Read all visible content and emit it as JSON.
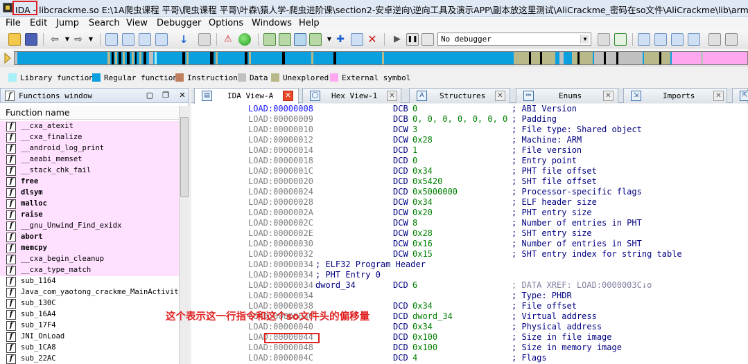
{
  "title_bar": {
    "app_name": "IDA - ",
    "title": "libcrackme.so E:\\1A爬虫课程 平哥\\爬虫课程 平哥\\叶森\\猿人学-爬虫进阶课\\section2-安卓逆向\\逆向工具及演示APP\\副本放这里测试\\AliCrackme_密码在so文件\\AliCrackme\\lib\\armeabi\\libcrackme.so"
  },
  "menu": [
    "File",
    "Edit",
    "Jump",
    "Search",
    "View",
    "Debugger",
    "Options",
    "Windows",
    "Help"
  ],
  "toolbar": {
    "debugger_select": "No debugger"
  },
  "legend": [
    {
      "label": "Library function",
      "color": "#a8f0f8"
    },
    {
      "label": "Regular function",
      "color": "#0aa0e0"
    },
    {
      "label": "Instruction",
      "color": "#c08060"
    },
    {
      "label": "Data",
      "color": "#c0c0c0"
    },
    {
      "label": "Unexplored",
      "color": "#b8b888"
    },
    {
      "label": "External symbol",
      "color": "#ffa8f0"
    }
  ],
  "functions_window": {
    "title": "Functions window",
    "column_header": "Function name",
    "items": [
      {
        "name": "__cxa_atexit",
        "kind": "imported"
      },
      {
        "name": "__cxa_finalize",
        "kind": "imported"
      },
      {
        "name": "__android_log_print",
        "kind": "imported"
      },
      {
        "name": "__aeabi_memset",
        "kind": "imported"
      },
      {
        "name": "__stack_chk_fail",
        "kind": "imported"
      },
      {
        "name": "free",
        "kind": "imported_bold"
      },
      {
        "name": "dlsym",
        "kind": "imported_bold"
      },
      {
        "name": "malloc",
        "kind": "imported_bold"
      },
      {
        "name": "raise",
        "kind": "imported_bold"
      },
      {
        "name": "__gnu_Unwind_Find_exidx",
        "kind": "imported"
      },
      {
        "name": "abort",
        "kind": "imported_bold"
      },
      {
        "name": "memcpy",
        "kind": "imported_bold"
      },
      {
        "name": "__cxa_begin_cleanup",
        "kind": "imported"
      },
      {
        "name": "__cxa_type_match",
        "kind": "imported"
      },
      {
        "name": "sub_1164",
        "kind": "regular"
      },
      {
        "name": "Java_com_yaotong_crackme_MainActivity_",
        "kind": "regular"
      },
      {
        "name": "sub_130C",
        "kind": "regular"
      },
      {
        "name": "sub_16A4",
        "kind": "regular"
      },
      {
        "name": "sub_17F4",
        "kind": "regular"
      },
      {
        "name": "JNI_OnLoad",
        "kind": "regular"
      },
      {
        "name": "sub_1CA8",
        "kind": "regular"
      },
      {
        "name": "sub_22AC",
        "kind": "regular"
      }
    ]
  },
  "tabs": [
    {
      "label": "IDA View-A",
      "icon": "ida-view-icon",
      "active": true
    },
    {
      "label": "Hex View-1",
      "icon": "hex-view-icon",
      "active": false
    },
    {
      "label": "Structures",
      "icon": "structures-icon",
      "active": false
    },
    {
      "label": "Enums",
      "icon": "enums-icon",
      "active": false
    },
    {
      "label": "Imports",
      "icon": "imports-icon",
      "active": false
    }
  ],
  "disassembly": [
    {
      "addr": "LOAD:00000008",
      "label": "",
      "mnem": "DCB",
      "ops": "0",
      "cmt": "; ABI Version",
      "current": true
    },
    {
      "addr": "LOAD:00000009",
      "label": "",
      "mnem": "DCB",
      "ops": "0, 0, 0, 0, 0, 0, 0",
      "cmt": "; Padding"
    },
    {
      "addr": "LOAD:00000010",
      "label": "",
      "mnem": "DCW",
      "ops": "3",
      "cmt": "; File type: Shared object"
    },
    {
      "addr": "LOAD:00000012",
      "label": "",
      "mnem": "DCW",
      "ops": "0x28",
      "cmt": "; Machine: ARM"
    },
    {
      "addr": "LOAD:00000014",
      "label": "",
      "mnem": "DCD",
      "ops": "1",
      "cmt": "; File version"
    },
    {
      "addr": "LOAD:00000018",
      "label": "",
      "mnem": "DCD",
      "ops": "0",
      "cmt": "; Entry point"
    },
    {
      "addr": "LOAD:0000001C",
      "label": "",
      "mnem": "DCD",
      "ops": "0x34",
      "cmt": "; PHT file offset"
    },
    {
      "addr": "LOAD:00000020",
      "label": "",
      "mnem": "DCD",
      "ops": "0x5420",
      "cmt": "; SHT file offset"
    },
    {
      "addr": "LOAD:00000024",
      "label": "",
      "mnem": "DCD",
      "ops": "0x5000000",
      "cmt": "; Processor-specific flags"
    },
    {
      "addr": "LOAD:00000028",
      "label": "",
      "mnem": "DCW",
      "ops": "0x34",
      "cmt": "; ELF header size"
    },
    {
      "addr": "LOAD:0000002A",
      "label": "",
      "mnem": "DCW",
      "ops": "0x20",
      "cmt": "; PHT entry size"
    },
    {
      "addr": "LOAD:0000002C",
      "label": "",
      "mnem": "DCW",
      "ops": "8",
      "cmt": "; Number of entries in PHT"
    },
    {
      "addr": "LOAD:0000002E",
      "label": "",
      "mnem": "DCW",
      "ops": "0x28",
      "cmt": "; SHT entry size"
    },
    {
      "addr": "LOAD:00000030",
      "label": "",
      "mnem": "DCW",
      "ops": "0x16",
      "cmt": "; Number of entries in SHT"
    },
    {
      "addr": "LOAD:00000032",
      "label": "",
      "mnem": "DCW",
      "ops": "0x15",
      "cmt": "; SHT entry index for string table"
    },
    {
      "addr": "LOAD:00000034",
      "label": "; ELF32 Program Header",
      "mnem": "",
      "ops": "",
      "cmt": ""
    },
    {
      "addr": "LOAD:00000034",
      "label": "; PHT Entry 0",
      "mnem": "",
      "ops": "",
      "cmt": ""
    },
    {
      "addr": "LOAD:00000034",
      "label": "dword_34",
      "mnem": "DCD",
      "ops": "6",
      "cmt": "; DATA XREF: LOAD:0000003C↓o",
      "gray": true
    },
    {
      "addr": "LOAD:00000034",
      "label": "",
      "mnem": "",
      "ops": "",
      "cmt": "; Type: PHDR"
    },
    {
      "addr": "LOAD:00000038",
      "label": "",
      "mnem": "DCD",
      "ops": "0x34",
      "cmt": "; File offset"
    },
    {
      "addr": "LOAD:0000003C",
      "label": "",
      "mnem": "DCD",
      "ops": "dword_34",
      "cmt": "; Virtual address"
    },
    {
      "addr": "LOAD:00000040",
      "label": "",
      "mnem": "DCD",
      "ops": "0x34",
      "cmt": "; Physical address"
    },
    {
      "addr": "LOAD:00000044",
      "label": "",
      "mnem": "DCD",
      "ops": "0x100",
      "cmt": "; Size in file image"
    },
    {
      "addr": "LOAD:00000048",
      "label": "",
      "mnem": "DCD",
      "ops": "0x100",
      "cmt": "; Size in memory image"
    },
    {
      "addr": "LOAD:0000004C",
      "label": "",
      "mnem": "DCD",
      "ops": "4",
      "cmt": "; Flags"
    }
  ],
  "annotation": {
    "text": "这个表示这一行指令和这个so文件头的偏移量",
    "color": "#e02020"
  }
}
